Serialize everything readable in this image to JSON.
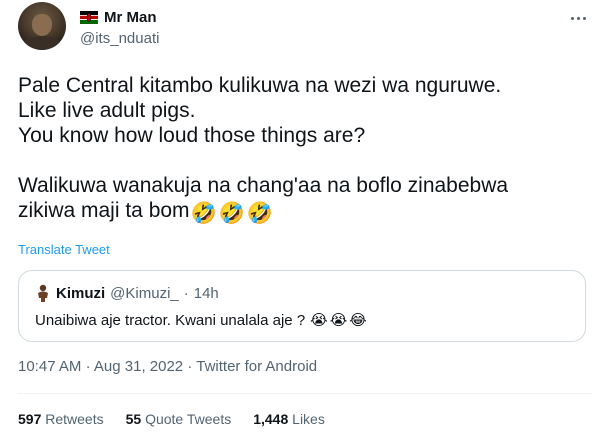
{
  "author": {
    "display_name": "Mr Man",
    "handle": "@its_nduati",
    "flag_icon": "kenya-flag-icon"
  },
  "tweet": {
    "lines": [
      "Pale Central kitambo kulikuwa na wezi wa nguruwe.",
      "Like live adult pigs.",
      "You know how loud those things are?",
      "",
      "Walikuwa wanakuja na chang'aa na boflo zinabebwa",
      "zikiwa maji ta bom"
    ],
    "trailing_emojis": [
      "🤣",
      "🤣",
      "🤣"
    ],
    "translate_label": "Translate Tweet"
  },
  "quoted_tweet": {
    "display_name": "Kimuzi",
    "handle": "@Kimuzi_",
    "separator": "·",
    "time": "14h",
    "text": "Unaibiwa aje tractor. Kwani unalala aje ?",
    "emojis": [
      "😭",
      "😭",
      "😂"
    ]
  },
  "meta": {
    "time": "10:47 AM",
    "date": "Aug 31, 2022",
    "source": "Twitter for Android",
    "separator": "·"
  },
  "stats": [
    {
      "count": "597",
      "label": "Retweets"
    },
    {
      "count": "55",
      "label": "Quote Tweets"
    },
    {
      "count": "1,448",
      "label": "Likes"
    }
  ],
  "colors": {
    "accent": "#1d9bf0",
    "text": "#0f1419",
    "secondary": "#536471",
    "border": "#cfd9de"
  }
}
